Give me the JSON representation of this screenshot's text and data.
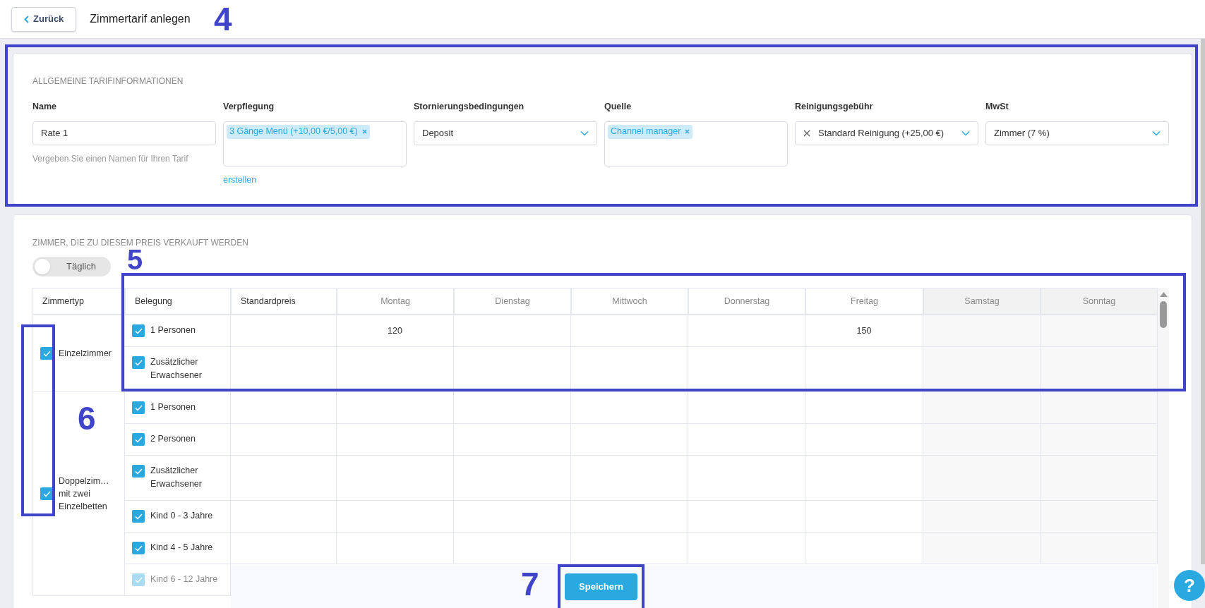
{
  "header": {
    "back_button": "Zurück",
    "title": "Zimmertarif anlegen"
  },
  "general": {
    "heading": "ALLGEMEINE TARIFINFORMATIONEN",
    "fields": [
      {
        "kind": "text",
        "label": "Name",
        "value": "Rate 1",
        "hint": "Vergeben Sie einen Namen für Ihren Tarif"
      },
      {
        "kind": "tags",
        "label": "Verpflegung",
        "tags": [
          "3 Gänge Menü (+10,00 €/5,00 €)"
        ],
        "link": "erstellen"
      },
      {
        "kind": "select",
        "label": "Stornierungsbedingungen",
        "value": "Deposit",
        "clearable": false
      },
      {
        "kind": "tags",
        "label": "Quelle",
        "tags": [
          "Channel manager"
        ]
      },
      {
        "kind": "select",
        "label": "Reinigungsgebühr",
        "value": "Standard Reinigung (+25,00 €)",
        "clearable": true
      },
      {
        "kind": "select",
        "label": "MwSt",
        "value": "Zimmer (7 %)",
        "clearable": false
      }
    ]
  },
  "rooms_section": {
    "heading": "ZIMMER, DIE ZU DIESEM PREIS VERKAUFT WERDEN",
    "toggle": {
      "label": "Täglich",
      "on": false
    },
    "columns": [
      {
        "label": "Zimmertyp",
        "kind": "room",
        "disabled": false
      },
      {
        "label": "Belegung",
        "kind": "rate",
        "disabled": false
      },
      {
        "label": "Standardpreis",
        "kind": "price",
        "disabled": false
      },
      {
        "label": "Montag",
        "kind": "day",
        "disabled": false
      },
      {
        "label": "Dienstag",
        "kind": "day",
        "disabled": false
      },
      {
        "label": "Mittwoch",
        "kind": "day",
        "disabled": false
      },
      {
        "label": "Donnerstag",
        "kind": "day",
        "disabled": false
      },
      {
        "label": "Freitag",
        "kind": "day",
        "disabled": false
      },
      {
        "label": "Samstag",
        "kind": "day",
        "disabled": true
      },
      {
        "label": "Sonntag",
        "kind": "day",
        "disabled": true
      }
    ],
    "rooms": [
      {
        "name": "Einzelzimmer",
        "checked": true,
        "rates": [
          {
            "label": "1 Personen",
            "checked": true,
            "faded": false,
            "cells": [
              "",
              "120",
              "",
              "",
              "",
              "150",
              "",
              ""
            ]
          },
          {
            "label": "Zusätzlicher Erwachsener",
            "checked": true,
            "faded": false,
            "cells": [
              "",
              "",
              "",
              "",
              "",
              "",
              "",
              ""
            ]
          }
        ]
      },
      {
        "name": "Doppelzim… mit zwei Einzelbetten",
        "checked": true,
        "rates": [
          {
            "label": "1 Personen",
            "checked": true,
            "faded": false,
            "cells": [
              "",
              "",
              "",
              "",
              "",
              "",
              "",
              ""
            ]
          },
          {
            "label": "2 Personen",
            "checked": true,
            "faded": false,
            "cells": [
              "",
              "",
              "",
              "",
              "",
              "",
              "",
              ""
            ]
          },
          {
            "label": "Zusätzlicher Erwachsener",
            "checked": true,
            "faded": false,
            "cells": [
              "",
              "",
              "",
              "",
              "",
              "",
              "",
              ""
            ]
          },
          {
            "label": "Kind 0 - 3 Jahre",
            "checked": true,
            "faded": false,
            "cells": [
              "",
              "",
              "",
              "",
              "",
              "",
              "",
              ""
            ]
          },
          {
            "label": "Kind 4 - 5 Jahre",
            "checked": true,
            "faded": false,
            "cells": [
              "",
              "",
              "",
              "",
              "",
              "",
              "",
              ""
            ]
          },
          {
            "label": "Kind 6 - 12 Jahre",
            "checked": true,
            "faded": true,
            "cells": [
              "",
              "",
              "",
              "",
              "",
              "",
              "",
              ""
            ]
          }
        ]
      }
    ]
  },
  "footer": {
    "save_button": "Speichern",
    "help_button": "?"
  },
  "annotations": [
    {
      "number": "4"
    },
    {
      "number": "5"
    },
    {
      "number": "6"
    },
    {
      "number": "7"
    }
  ]
}
